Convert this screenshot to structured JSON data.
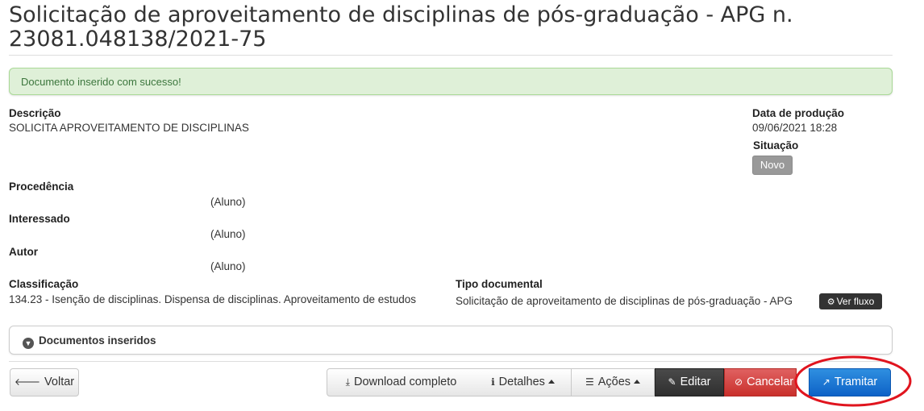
{
  "header": {
    "title_line1": "Solicitação de aproveitamento de disciplinas de pós-graduação - APG n.",
    "title_line2": "23081.048138/2021-75"
  },
  "alert": {
    "message": "Documento inserido com sucesso!"
  },
  "fields": {
    "descricao_label": "Descrição",
    "descricao_value": "SOLICITA APROVEITAMENTO DE DISCIPLINAS",
    "data_producao_label": "Data de produção",
    "data_producao_value": "09/06/2021 18:28",
    "situacao_label": "Situação",
    "situacao_value": "Novo",
    "procedencia_label": "Procedência",
    "procedencia_value": "(Aluno)",
    "interessado_label": "Interessado",
    "interessado_value": "(Aluno)",
    "autor_label": "Autor",
    "autor_value": "(Aluno)",
    "classificacao_label": "Classificação",
    "classificacao_value": "134.23 - Isenção de disciplinas. Dispensa de disciplinas. Aproveitamento de estudos",
    "tipo_documental_label": "Tipo documental",
    "tipo_documental_value": "Solicitação de aproveitamento de disciplinas de pós-graduação - APG",
    "ver_fluxo_label": "Ver fluxo"
  },
  "panel": {
    "documentos_inseridos_label": "Documentos inseridos"
  },
  "footer": {
    "voltar": "Voltar",
    "download": "Download completo",
    "detalhes": "Detalhes",
    "acoes": "Ações",
    "editar": "Editar",
    "cancelar": "Cancelar",
    "tramitar": "Tramitar"
  },
  "colors": {
    "alert_bg": "#dff0d8",
    "alert_text": "#3c763d",
    "badge_bg": "#999999",
    "editar_bg": "#333333",
    "cancelar_bg": "#d9534f",
    "tramitar_bg": "#1a73d9",
    "annotation": "#e0141e"
  }
}
